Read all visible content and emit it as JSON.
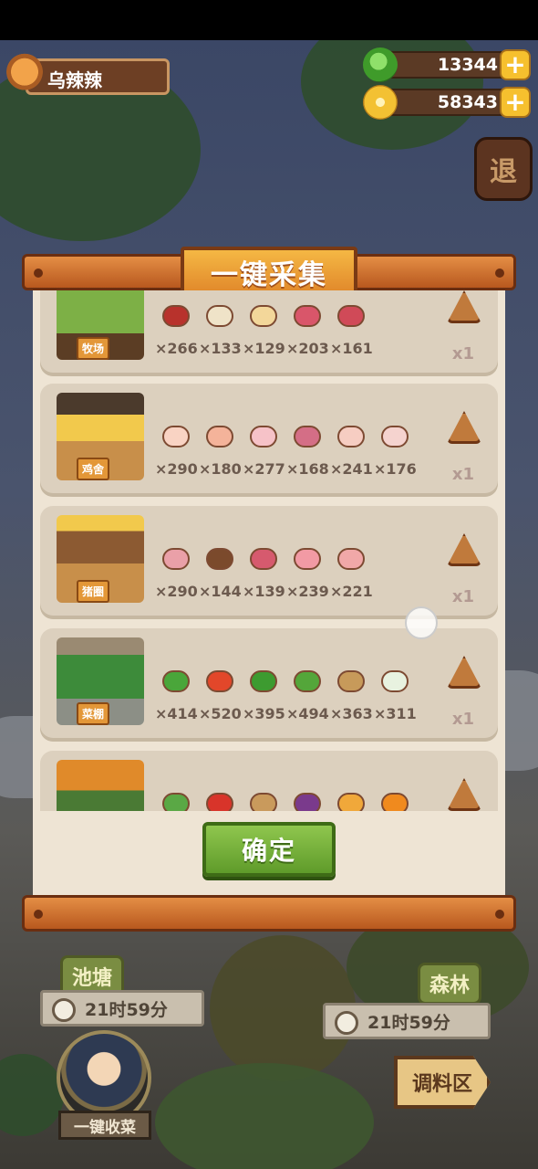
{
  "player": {
    "name": "乌辣辣"
  },
  "currency": [
    {
      "icon": "green-gem-icon",
      "value": "13344",
      "color": "#4fb236"
    },
    {
      "icon": "gold-coin-icon",
      "value": "58343",
      "color": "#f0b52a"
    }
  ],
  "exit_label": "退",
  "dialog": {
    "title": "一键采集",
    "confirm_label": "确定",
    "cards": [
      {
        "building": "牧场",
        "badge_icon": "thermometer-icon",
        "multiplier": "x1",
        "items": [
          {
            "icon": "red-meat-icon",
            "color": "#b8322c",
            "count": "×266"
          },
          {
            "icon": "milk-box-icon",
            "color": "#efe3c8",
            "count": "×133"
          },
          {
            "icon": "cheese-icon",
            "color": "#f3d79a",
            "count": "×129"
          },
          {
            "icon": "steak-icon",
            "color": "#d9566a",
            "count": "×203"
          },
          {
            "icon": "beef-slice-icon",
            "color": "#d04a58",
            "count": "×161"
          }
        ]
      },
      {
        "building": "鸡舍",
        "badge_icon": "orange-slice-icon",
        "multiplier": "x1",
        "items": [
          {
            "icon": "egg-icon",
            "color": "#f9d3c3",
            "count": "×290"
          },
          {
            "icon": "chicken-breast-icon",
            "color": "#f4b39a",
            "count": "×180"
          },
          {
            "icon": "chicken-icon",
            "color": "#f6c2c8",
            "count": "×277"
          },
          {
            "icon": "chicken-meat-icon",
            "color": "#d46e86",
            "count": "×168"
          },
          {
            "icon": "drumstick-icon",
            "color": "#f6cdc2",
            "count": "×241"
          },
          {
            "icon": "whole-chicken-icon",
            "color": "#f5d3cf",
            "count": "×176"
          }
        ]
      },
      {
        "building": "猪圈",
        "badge_icon": "seal-icon",
        "multiplier": "x1",
        "items": [
          {
            "icon": "bacon-icon",
            "color": "#eaa0a8",
            "count": "×290"
          },
          {
            "icon": "pork-bowl-icon",
            "color": "#7b4a2c",
            "count": "×144"
          },
          {
            "icon": "pork-belly-icon",
            "color": "#d65a6e",
            "count": "×139"
          },
          {
            "icon": "pork-slice-icon",
            "color": "#f29aa4",
            "count": "×239"
          },
          {
            "icon": "ham-icon",
            "color": "#f1a8a8",
            "count": "×221"
          }
        ]
      },
      {
        "building": "菜棚",
        "badge_icon": "thermometer-icon",
        "multiplier": "x1",
        "items": [
          {
            "icon": "bok-choy-icon",
            "color": "#4aa63a",
            "count": "×414"
          },
          {
            "icon": "tomato-icon",
            "color": "#e2472a",
            "count": "×520"
          },
          {
            "icon": "pepper-icon",
            "color": "#3d9b30",
            "count": "×395"
          },
          {
            "icon": "cucumber-icon",
            "color": "#54a63a",
            "count": "×494"
          },
          {
            "icon": "seed-box-icon",
            "color": "#c79a5a",
            "count": "×363"
          },
          {
            "icon": "radish-icon",
            "color": "#e8f2e0",
            "count": "×311"
          }
        ]
      },
      {
        "building": "",
        "badge_icon": "seal-icon",
        "multiplier": "",
        "items": [
          {
            "icon": "scallion-icon",
            "color": "#5aa845",
            "count": ""
          },
          {
            "icon": "chili-icon",
            "color": "#d8342a",
            "count": ""
          },
          {
            "icon": "mushroom-icon",
            "color": "#c99a5c",
            "count": ""
          },
          {
            "icon": "eggplant-icon",
            "color": "#7a3a8c",
            "count": ""
          },
          {
            "icon": "pineapple-icon",
            "color": "#f0a83a",
            "count": ""
          },
          {
            "icon": "pumpkin-icon",
            "color": "#f08a1e",
            "count": ""
          }
        ]
      }
    ]
  },
  "areas": {
    "pond": {
      "label": "池塘",
      "timer": "21时59分"
    },
    "forest": {
      "label": "森林",
      "timer": "21时59分"
    }
  },
  "harvest_label": "一键收菜",
  "seasoning_label": "调料区"
}
